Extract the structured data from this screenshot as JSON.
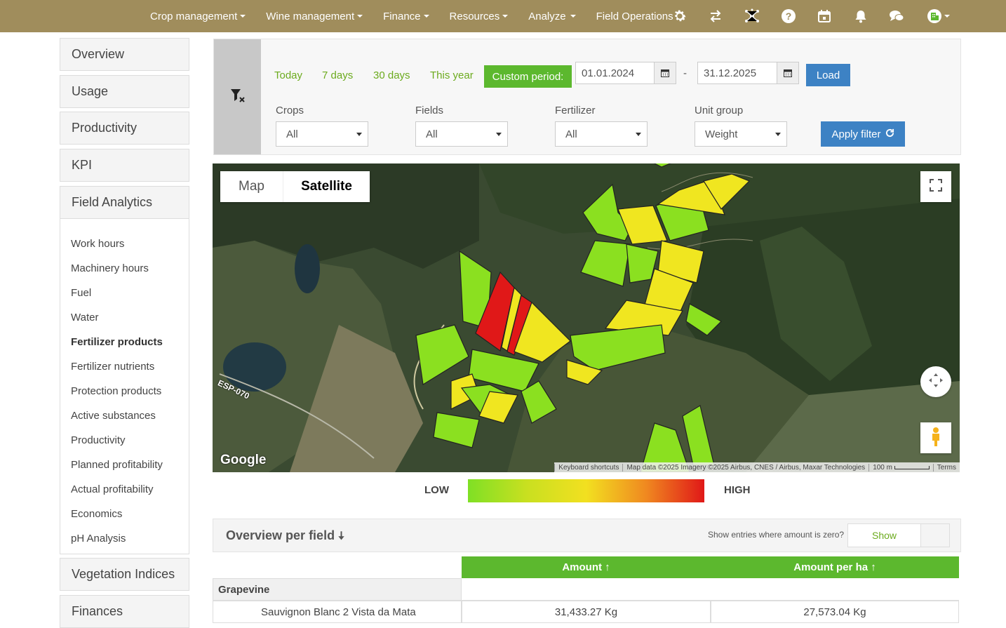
{
  "topnav": {
    "items": [
      {
        "label": "Crop management",
        "has_caret": true
      },
      {
        "label": "Wine management",
        "has_caret": true
      },
      {
        "label": "Finance",
        "has_caret": true
      },
      {
        "label": "Resources",
        "has_caret": true
      },
      {
        "label": "Analyze",
        "has_caret": true
      },
      {
        "label": "Field Operations",
        "has_caret": false
      }
    ],
    "icons": [
      "gear-icon",
      "swap-icon",
      "network-icon",
      "help-icon",
      "calendar-icon",
      "bell-icon",
      "chat-icon",
      "company-icon"
    ]
  },
  "sidebar": {
    "top_items": [
      "Overview",
      "Usage",
      "Productivity",
      "KPI",
      "Field Analytics"
    ],
    "sub_items": [
      "Work hours",
      "Machinery hours",
      "Fuel",
      "Water",
      "Fertilizer products",
      "Fertilizer nutrients",
      "Protection products",
      "Active substances",
      "Productivity",
      "Planned profitability",
      "Actual profitability",
      "Economics",
      "pH Analysis"
    ],
    "active_sub": "Fertilizer products",
    "bottom_items": [
      "Vegetation Indices",
      "Finances"
    ]
  },
  "filters": {
    "periods": [
      "Today",
      "7 days",
      "30 days",
      "This year"
    ],
    "custom_period_label": "Custom period:",
    "date_from": "01.01.2024",
    "date_separator": "-",
    "date_to": "31.12.2025",
    "load_label": "Load",
    "crops": {
      "label": "Crops",
      "value": "All"
    },
    "fields": {
      "label": "Fields",
      "value": "All"
    },
    "fertilizer": {
      "label": "Fertilizer",
      "value": "All"
    },
    "unit_group": {
      "label": "Unit group",
      "value": "Weight"
    },
    "apply_label": "Apply filter"
  },
  "map": {
    "type_map": "Map",
    "type_satellite": "Satellite",
    "selected_type": "Satellite",
    "road_label": "ESP-070",
    "google": "Google",
    "attribution": {
      "shortcuts": "Keyboard shortcuts",
      "data": "Map data ©2025 Imagery ©2025 Airbus, CNES / Airbus, Maxar Technologies",
      "scale": "100 m",
      "terms": "Terms"
    }
  },
  "legend": {
    "low": "LOW",
    "high": "HIGH",
    "colors": [
      "#7fe025",
      "#f2e020",
      "#e01818"
    ]
  },
  "overview": {
    "title": "Overview per field",
    "zero_label": "Show entries where amount is zero?",
    "show_label": "Show",
    "columns": [
      "Amount ↑",
      "Amount per ha ↑"
    ],
    "group": "Grapevine",
    "rows": [
      {
        "field": "Sauvignon Blanc 2 Vista da Mata",
        "amount": "31,433.27 Kg",
        "amount_per_ha": "27,573.04 Kg"
      }
    ]
  }
}
